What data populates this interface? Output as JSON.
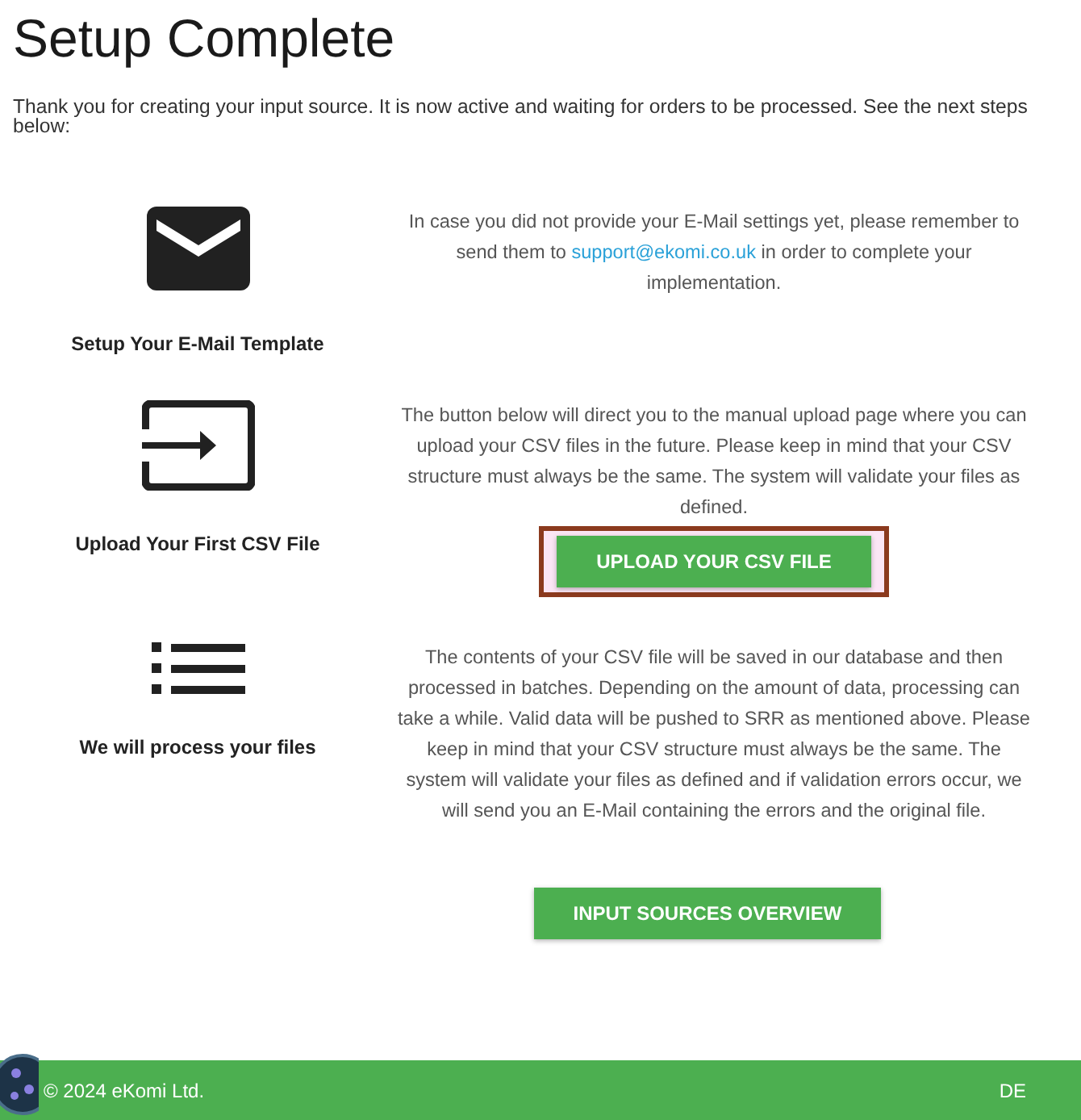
{
  "title": "Setup Complete",
  "intro": "Thank you for creating your input source. It is now active and waiting for orders to be processed. See the next steps below:",
  "steps": [
    {
      "kind": "mail",
      "label": "Setup Your E-Mail Template",
      "description": [
        {
          "kind": "text",
          "text": "In case you did not provide your E-Mail settings yet, please remember to send them to "
        },
        {
          "kind": "link",
          "text": "support@ekomi.co.uk"
        },
        {
          "kind": "text",
          "text": " in order to complete your implementation."
        }
      ]
    },
    {
      "kind": "input",
      "label": "Upload Your First CSV File",
      "description": [
        {
          "kind": "text",
          "text": "The button below will direct you to the manual upload page where you can upload your CSV files in the future. Please keep in mind that your CSV structure must always be the same. The system will validate your files as defined."
        }
      ],
      "button": {
        "label": "UPLOAD YOUR CSV FILE",
        "highlighted": true
      }
    },
    {
      "kind": "list",
      "label": "We will process your files",
      "description": [
        {
          "kind": "text",
          "text": "The contents of your CSV file will be saved in our database and then processed in batches. Depending on the amount of data, processing can take a while. Valid data will be pushed to SRR as mentioned above. Please keep in mind that your CSV structure must always be the same. The system will validate your files as defined and if validation errors occur, we will send you an E-Mail containing the errors and the original file."
        }
      ]
    }
  ],
  "overview_button": {
    "label": "INPUT SOURCES OVERVIEW",
    "highlighted": false
  },
  "footer": {
    "copyright": "© 2024 eKomi Ltd.",
    "language": "DE"
  }
}
